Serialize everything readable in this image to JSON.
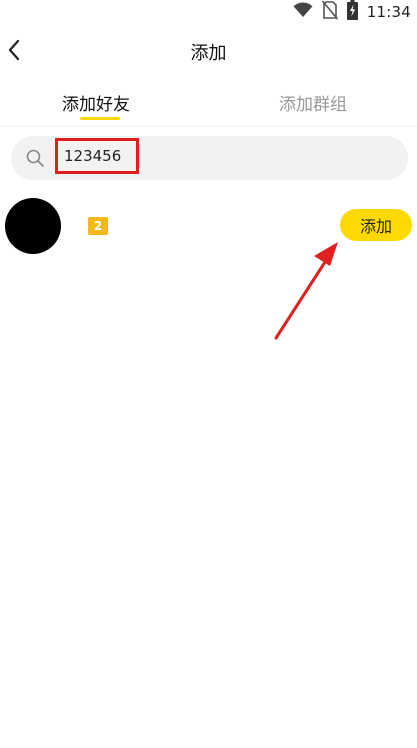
{
  "status_bar": {
    "time": "11:34",
    "icons": [
      "wifi-icon",
      "no-sim-icon",
      "battery-charging-icon"
    ]
  },
  "nav": {
    "title": "添加",
    "back_icon": "chevron-left-icon"
  },
  "tabs": [
    {
      "label": "添加好友",
      "active": true
    },
    {
      "label": "添加群组",
      "active": false
    }
  ],
  "search": {
    "icon": "search-icon",
    "value": "123456"
  },
  "result": {
    "avatar": "avatar",
    "level": "2",
    "add_label": "添加"
  },
  "colors": {
    "accent": "#FFD900",
    "badge": "#F5B81B",
    "annotation": "#E02020",
    "inactive_tab": "#999999"
  }
}
